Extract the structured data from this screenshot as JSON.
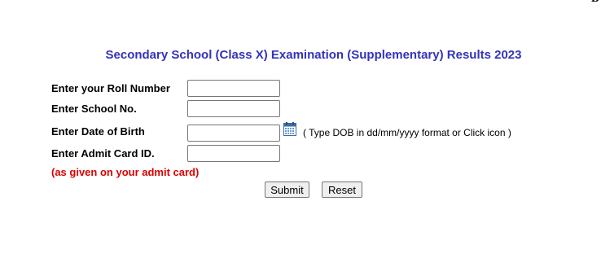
{
  "corner": "B",
  "title": "Secondary School (Class X) Examination (Supplementary) Results 2023",
  "form": {
    "roll_label": "Enter your Roll Number",
    "roll_value": "",
    "school_label": "Enter School No.",
    "school_value": "",
    "dob_label": "Enter Date of Birth",
    "dob_value": "",
    "dob_hint": "( Type DOB in dd/mm/yyyy format or Click icon )",
    "dob_icon": "calendar-icon",
    "admit_label": "Enter Admit Card ID.",
    "admit_value": "",
    "admit_note": "(as given on your admit card)"
  },
  "buttons": {
    "submit": "Submit",
    "reset": "Reset"
  },
  "colors": {
    "title": "#3333bb",
    "note": "#dd0000"
  }
}
